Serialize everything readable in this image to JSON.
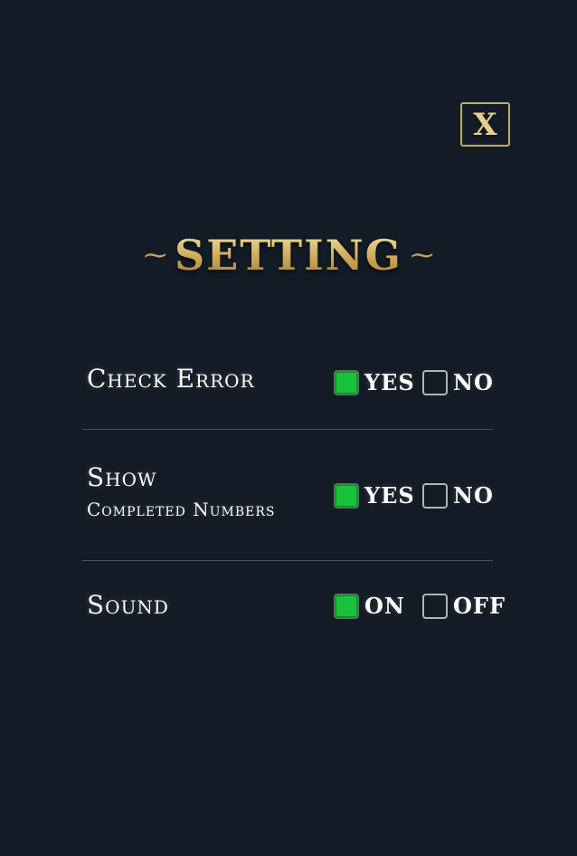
{
  "close_label": "X",
  "title": "SETTING",
  "rows": [
    {
      "label_line1": "Check Error",
      "option_a": "YES",
      "option_b": "NO",
      "selected": "option_a"
    },
    {
      "label_line1": "Show",
      "label_line2": "Completed Numbers",
      "option_a": "YES",
      "option_b": "NO",
      "selected": "option_a"
    },
    {
      "label_line1": "Sound",
      "option_a": "ON",
      "option_b": "OFF",
      "selected": "option_a"
    }
  ],
  "colors": {
    "background": "#131c26",
    "gold": "#c9a85a",
    "checked": "#18c23a"
  }
}
